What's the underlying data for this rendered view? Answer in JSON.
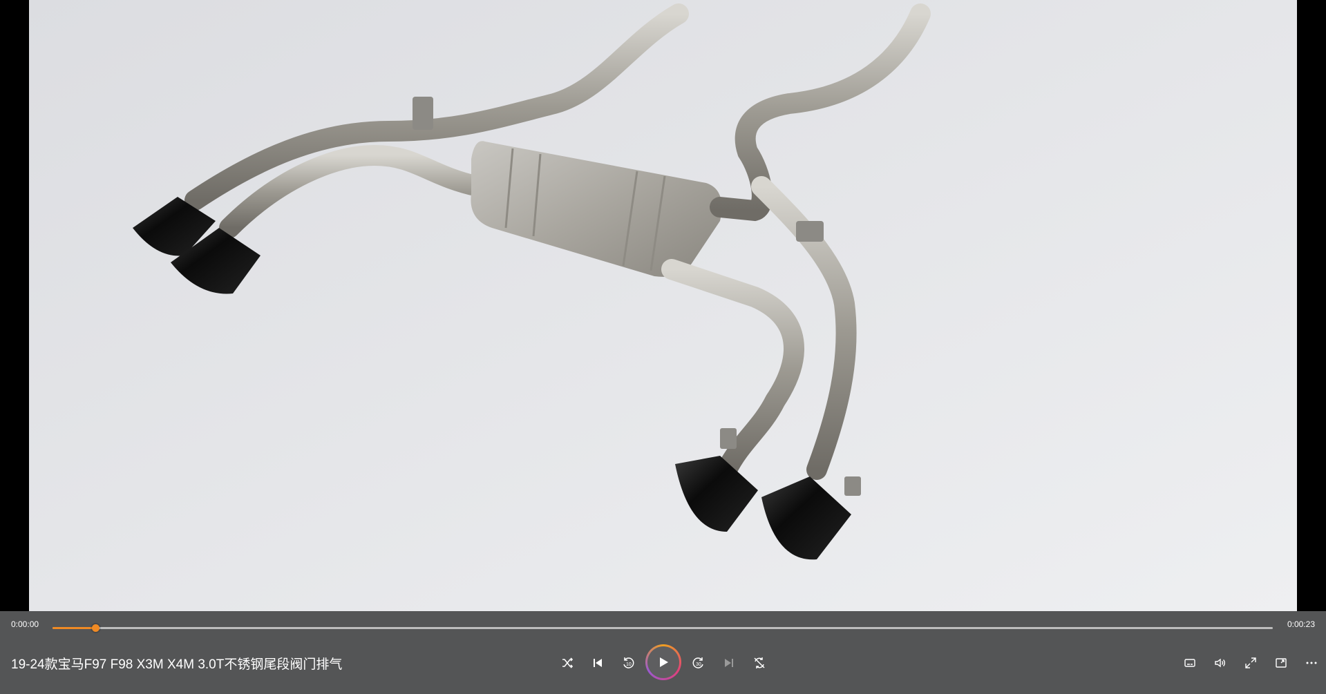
{
  "player": {
    "current_time": "0:00:00",
    "total_time": "0:00:23",
    "progress": 0.035,
    "accent_color": "#f08a24",
    "title": "19-24款宝马F97 F98 X3M X4M 3.0T不锈钢尾段阀门排气"
  },
  "controls": {
    "center": [
      "shuffle-icon",
      "previous-icon",
      "rewind-10-icon",
      "play-icon",
      "forward-30-icon",
      "next-icon",
      "repeat-off-icon"
    ],
    "right": [
      "subtitles-icon",
      "volume-icon",
      "fullscreen-icon",
      "mini-player-icon",
      "more-options-icon"
    ]
  }
}
